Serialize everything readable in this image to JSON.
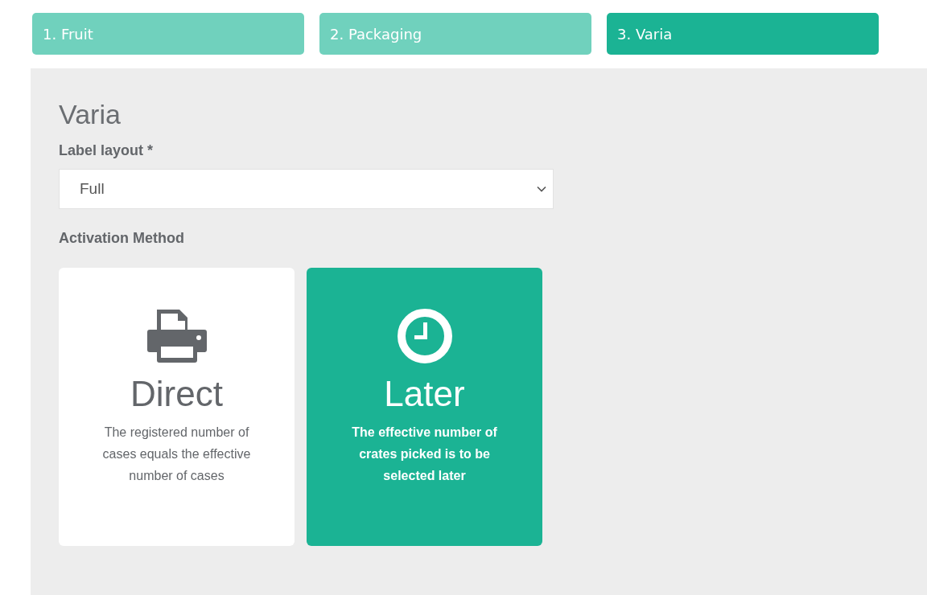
{
  "steps": [
    {
      "label": "1. Fruit",
      "selected": false
    },
    {
      "label": "2. Packaging",
      "selected": false
    },
    {
      "label": "3. Varia",
      "selected": true
    }
  ],
  "section": {
    "title": "Varia",
    "label_layout": {
      "label": "Label layout *",
      "value": "Full"
    },
    "activation": {
      "label": "Activation Method",
      "options": [
        {
          "kind": "printer",
          "title": "Direct",
          "description": "The registered number of cases equals the effective number of cases",
          "selected": false
        },
        {
          "kind": "clock",
          "title": "Later",
          "description": "The effective number of crates picked is to be selected later",
          "selected": true
        }
      ]
    }
  }
}
